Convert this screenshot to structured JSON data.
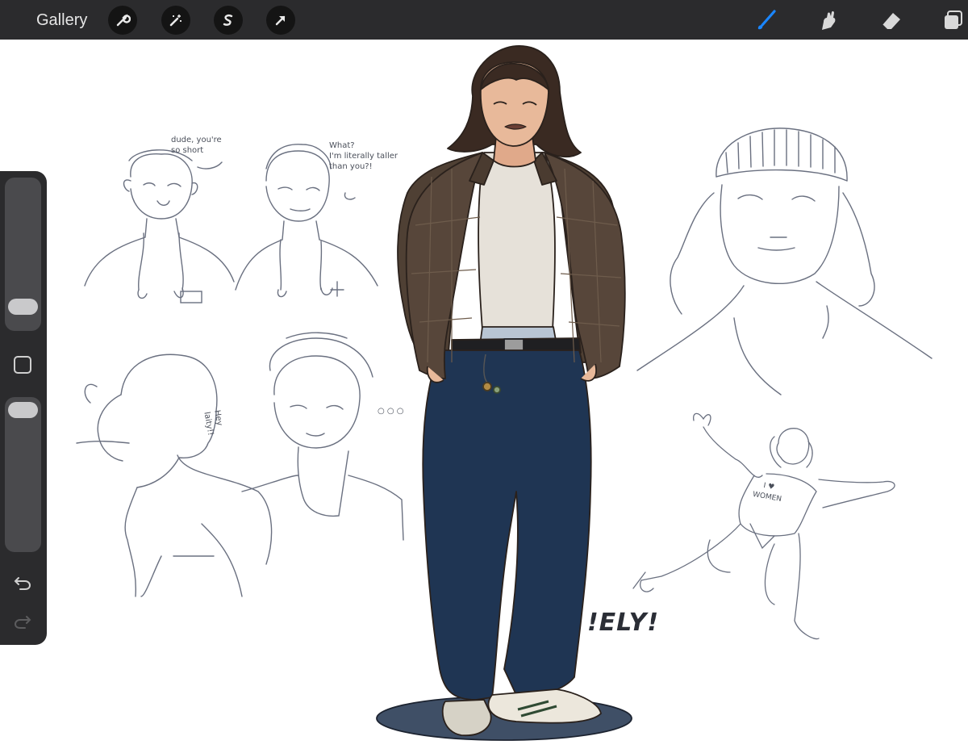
{
  "toolbar": {
    "gallery_label": "Gallery",
    "left_tools": [
      "wrench-icon",
      "magic-wand-icon",
      "selection-icon",
      "transform-arrow-icon"
    ],
    "right_tools": [
      "brush-icon",
      "smudge-icon",
      "eraser-icon",
      "layers-icon"
    ],
    "active_tool": "brush-icon",
    "active_color": "#1a86ff"
  },
  "sidebar": {
    "brush_size": 0.3,
    "opacity": 0.95,
    "icons": [
      "modify-square-icon",
      "undo-icon",
      "redo-icon"
    ]
  },
  "canvas": {
    "notes": {
      "dude": "dude, you're\nso short",
      "what": "What?\nI'm literally taller\nthan you?!",
      "hey": "Hey\nlaity!!",
      "dots": "○ ○ ○",
      "shirt": "I ♥\nWOMEN"
    },
    "title_text": "!ELY!",
    "colors": {
      "jacket": "#4f4034",
      "jeans": "#1f3553",
      "shirt": "#e6e1d9",
      "hair": "#3a2a22",
      "skin": "#e8b99a",
      "sketch": "#6a7080"
    }
  }
}
